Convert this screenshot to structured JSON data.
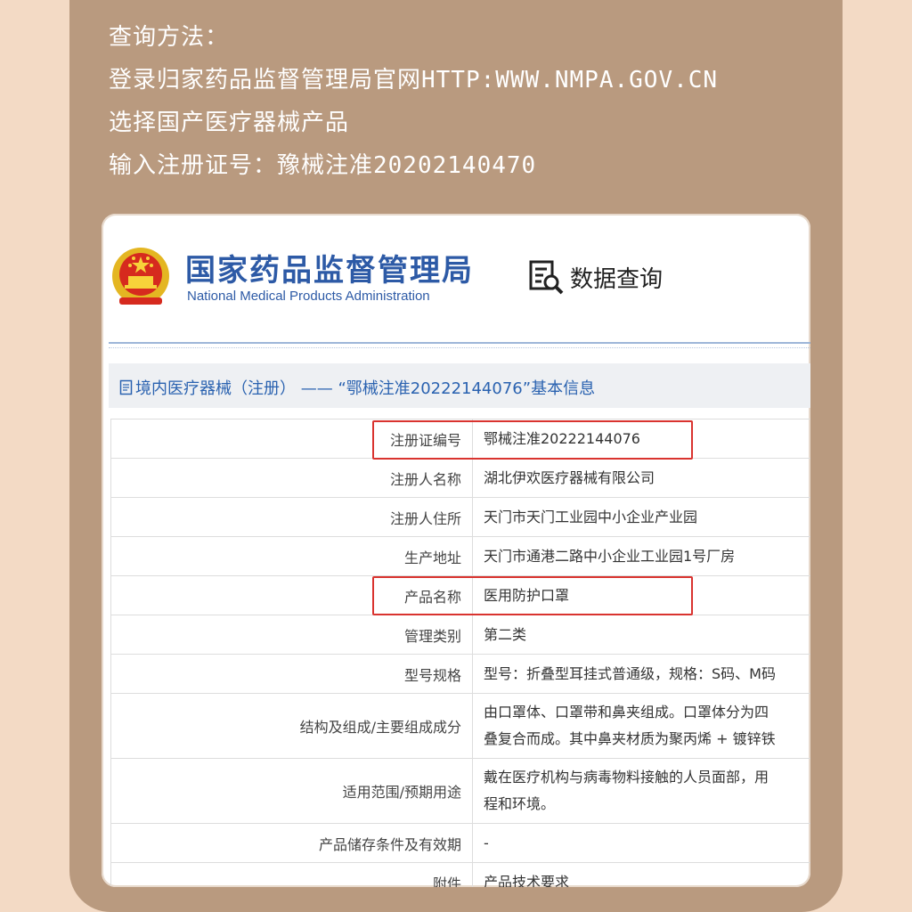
{
  "intro": {
    "line1": "查询方法：",
    "line2": "登录归家药品监督管理局官网HTTP:WWW.NMPA.GOV.CN",
    "line3": "选择国产医疗器械产品",
    "line4": "输入注册证号：豫械注准20202140470"
  },
  "header": {
    "org_cn": "国家药品监督管理局",
    "org_en": "National Medical Products Administration",
    "query_label": "数据查询",
    "emblem_icon": "national-emblem-icon",
    "query_icon": "document-search-icon"
  },
  "section": {
    "title": "境内医疗器械（注册） —— “鄂械注准20222144076”基本信息"
  },
  "table": {
    "rows": [
      {
        "label": "注册证编号",
        "value": "鄂械注准20222144076"
      },
      {
        "label": "注册人名称",
        "value": "湖北伊欢医疗器械有限公司"
      },
      {
        "label": "注册人住所",
        "value": "天门市天门工业园中小企业产业园"
      },
      {
        "label": "生产地址",
        "value": "天门市通港二路中小企业工业园1号厂房"
      },
      {
        "label": "产品名称",
        "value": "医用防护口罩"
      },
      {
        "label": "管理类别",
        "value": "第二类"
      },
      {
        "label": "型号规格",
        "value": "型号：折叠型耳挂式普通级，规格：S码、M码"
      },
      {
        "label": "结构及组成/主要组成成分",
        "value_line1": "由口罩体、口罩带和鼻夹组成。口罩体分为四",
        "value_line2": "叠复合而成。其中鼻夹材质为聚丙烯 + 镀锌铁"
      },
      {
        "label": "适用范围/预期用途",
        "value_line1": "戴在医疗机构与病毒物料接触的人员面部，用",
        "value_line2": "程和环境。"
      },
      {
        "label": "产品储存条件及有效期",
        "value": "-"
      },
      {
        "label": "附件",
        "value": "产品技术要求"
      }
    ]
  },
  "colors": {
    "accent_blue": "#2d5aa6",
    "highlight_red": "#d9332f",
    "frame_brown": "#b99a7f",
    "background_peach": "#f3dac5"
  }
}
